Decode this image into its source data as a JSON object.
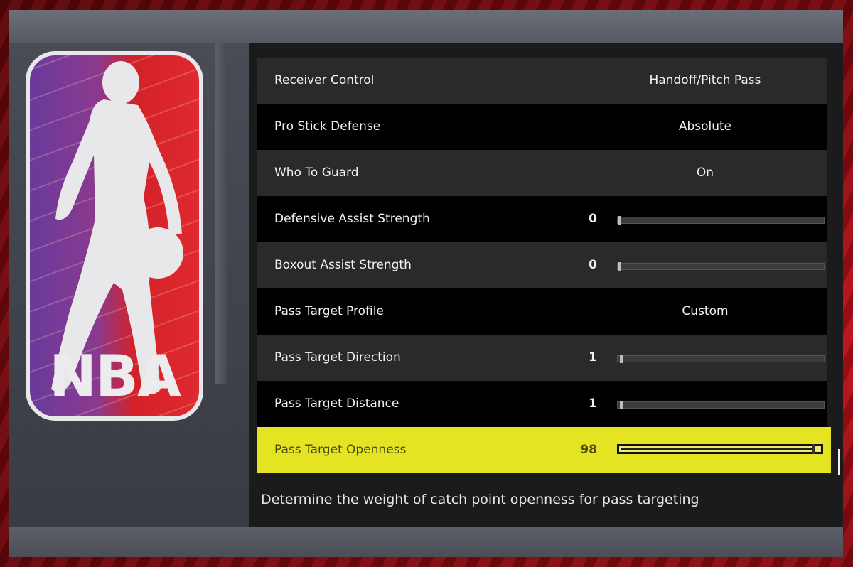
{
  "logo": {
    "text": "NBA",
    "icon": "nba-logo-icon",
    "colors": {
      "blue": "#6a3a9c",
      "red": "#d42128"
    }
  },
  "settings": [
    {
      "label": "Receiver Control",
      "type": "text",
      "value": "Handoff/Pitch Pass"
    },
    {
      "label": "Pro Stick Defense",
      "type": "text",
      "value": "Absolute"
    },
    {
      "label": "Who To Guard",
      "type": "text",
      "value": "On"
    },
    {
      "label": "Defensive Assist Strength",
      "type": "slider",
      "value": "0",
      "fraction": 0
    },
    {
      "label": "Boxout Assist Strength",
      "type": "slider",
      "value": "0",
      "fraction": 0
    },
    {
      "label": "Pass Target Profile",
      "type": "text",
      "value": "Custom"
    },
    {
      "label": "Pass Target Direction",
      "type": "slider",
      "value": "1",
      "fraction": 0.01
    },
    {
      "label": "Pass Target Distance",
      "type": "slider",
      "value": "1",
      "fraction": 0.01
    },
    {
      "label": "Pass Target Openness",
      "type": "slider",
      "value": "98",
      "fraction": 0.98,
      "selected": true
    }
  ],
  "description": "Determine the weight of catch point openness for pass targeting",
  "colors": {
    "highlight": "#e4e422",
    "panel": "#1b1b1d"
  }
}
